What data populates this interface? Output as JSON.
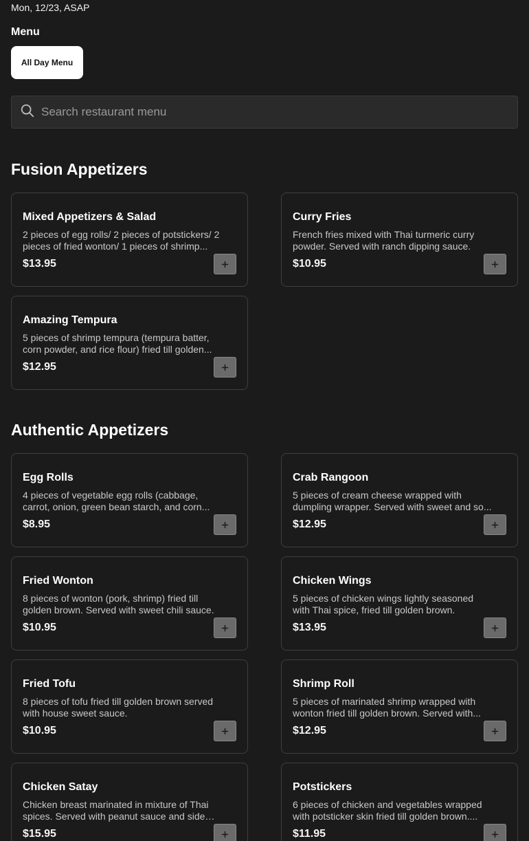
{
  "header": {
    "order_info": "Mon, 12/23, ASAP",
    "menu_label": "Menu",
    "menu_tab": "All Day Menu"
  },
  "search": {
    "placeholder": "Search restaurant menu"
  },
  "sections": [
    {
      "title": "Fusion Appetizers",
      "items": [
        {
          "name": "Mixed Appetizers & Salad",
          "desc": "2 pieces of egg rolls/ 2 pieces of potstickers/ 2 pieces of fried wonton/ 1 pieces of shrimp...",
          "price": "$13.95"
        },
        {
          "name": "Curry Fries",
          "desc": "French fries mixed with Thai turmeric curry powder. Served with ranch dipping sauce.",
          "price": "$10.95"
        },
        {
          "name": "Amazing Tempura",
          "desc": "5 pieces of shrimp tempura (tempura batter, corn powder, and rice flour) fried till golden...",
          "price": "$12.95"
        }
      ]
    },
    {
      "title": "Authentic Appetizers",
      "items": [
        {
          "name": "Egg Rolls",
          "desc": "4 pieces of vegetable egg rolls (cabbage, carrot, onion, green bean starch, and corn...",
          "price": "$8.95"
        },
        {
          "name": "Crab Rangoon",
          "desc": "5 pieces of cream cheese wrapped with dumpling wrapper. Served with sweet and so...",
          "price": "$12.95"
        },
        {
          "name": "Fried Wonton",
          "desc": "8 pieces of wonton (pork, shrimp) fried till golden brown. Served with sweet chili sauce.",
          "price": "$10.95"
        },
        {
          "name": "Chicken Wings",
          "desc": "5 pieces of chicken wings lightly seasoned with Thai spice, fried till golden brown.",
          "price": "$13.95"
        },
        {
          "name": "Fried Tofu",
          "desc": "8 pieces of tofu fried till golden brown served with house sweet sauce.",
          "price": "$10.95"
        },
        {
          "name": "Shrimp Roll",
          "desc": "5 pieces of marinated shrimp wrapped with wonton fried till golden brown. Served with...",
          "price": "$12.95"
        },
        {
          "name": "Chicken Satay",
          "desc": "Chicken breast marinated in mixture of Thai spices. Served with peanut sauce and side of...",
          "price": "$15.95"
        },
        {
          "name": "Potstickers",
          "desc": "6 pieces of chicken and vegetables wrapped with potsticker skin fried till golden brown....",
          "price": "$11.95"
        }
      ]
    }
  ],
  "icons": {
    "search": "search-icon",
    "add": "plus-icon"
  },
  "colors": {
    "background": "#1b1b1b",
    "card_border": "#3f3f3f",
    "add_button": "#6a6a6a"
  }
}
